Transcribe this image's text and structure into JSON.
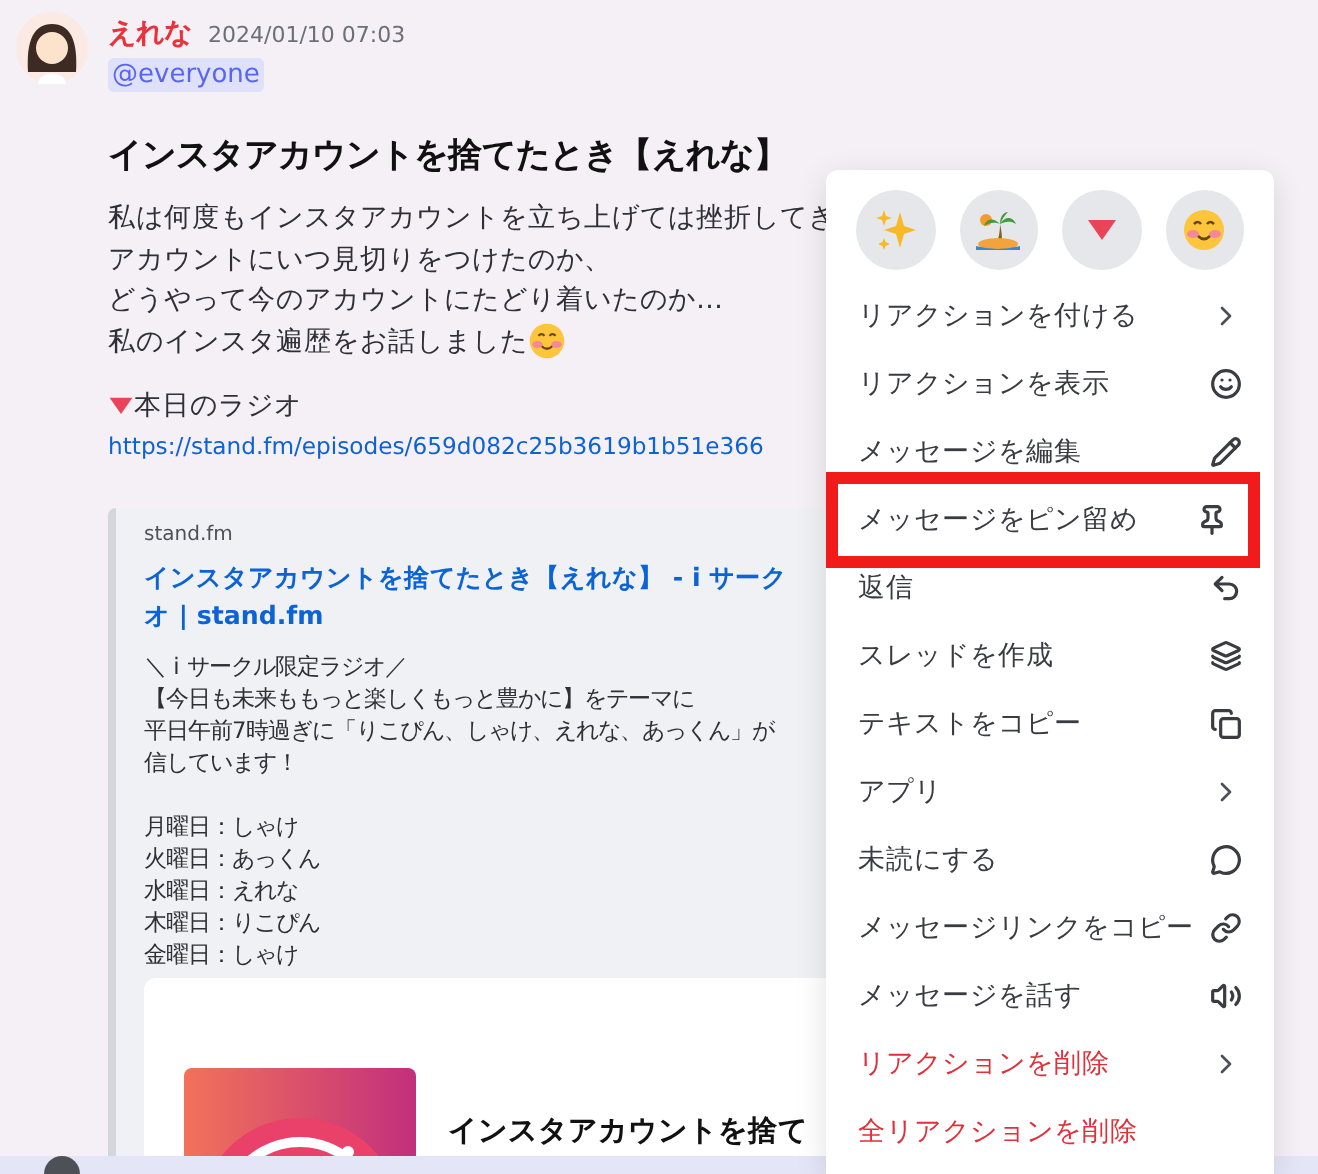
{
  "message": {
    "author": "えれな",
    "timestamp": "2024/01/10 07:03",
    "mention": "@everyone",
    "title": "インスタアカウントを捨てたとき【えれな】",
    "body": [
      "私は何度もインスタアカウントを立ち上げては挫折してき",
      "アカウントにいつ見切りをつけたのか、",
      "どうやって今のアカウントにたどり着いたのか…",
      "私のインスタ遍歴をお話しました"
    ],
    "radio_label": "本日のラジオ",
    "link": "https://stand.fm/episodes/659d082c25b3619b1b51e366",
    "embed": {
      "provider": "stand.fm",
      "title_lines": [
        "インスタアカウントを捨てたとき【えれな】 - i サーク",
        "オ | stand.fm"
      ],
      "description": [
        "＼ i サークル限定ラジオ／",
        "【今日も未来ももっと楽しくもっと豊かに】をテーマに",
        "平日午前7時過ぎに「りこぴん、しゃけ、えれな、あっくん」が",
        "信しています！"
      ],
      "schedule": [
        "月曜日：しゃけ",
        "火曜日：あっくん",
        "水曜日：えれな",
        "木曜日：りこぴん",
        "金曜日：しゃけ"
      ],
      "card_title": "インスタアカウントを捨て"
    }
  },
  "context_menu": {
    "items": [
      {
        "label": "リアクションを付ける",
        "kind": "submenu",
        "danger": false,
        "highlighted": false
      },
      {
        "label": "リアクションを表示",
        "kind": "action",
        "danger": false,
        "highlighted": false
      },
      {
        "label": "メッセージを編集",
        "kind": "action",
        "danger": false,
        "highlighted": false
      },
      {
        "label": "メッセージをピン留め",
        "kind": "action",
        "danger": false,
        "highlighted": true
      },
      {
        "label": "返信",
        "kind": "action",
        "danger": false,
        "highlighted": false
      },
      {
        "label": "スレッドを作成",
        "kind": "action",
        "danger": false,
        "highlighted": false
      },
      {
        "label": "テキストをコピー",
        "kind": "action",
        "danger": false,
        "highlighted": false
      },
      {
        "label": "アプリ",
        "kind": "submenu",
        "danger": false,
        "highlighted": false
      },
      {
        "label": "未読にする",
        "kind": "action",
        "danger": false,
        "highlighted": false
      },
      {
        "label": "メッセージリンクをコピー",
        "kind": "action",
        "danger": false,
        "highlighted": false
      },
      {
        "label": "メッセージを話す",
        "kind": "action",
        "danger": false,
        "highlighted": false
      },
      {
        "label": "リアクションを削除",
        "kind": "submenu",
        "danger": true,
        "highlighted": false
      },
      {
        "label": "全リアクションを削除",
        "kind": "plain",
        "danger": true,
        "highlighted": false
      }
    ]
  }
}
